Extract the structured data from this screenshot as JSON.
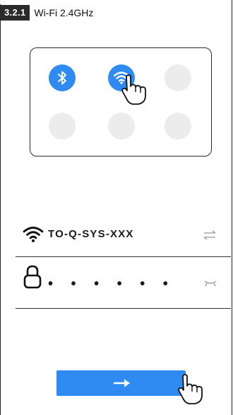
{
  "header": {
    "section_number": "3.2.1",
    "title": "Wi-Fi 2.4GHz"
  },
  "control_center": {
    "toggles": [
      {
        "name": "bluetooth",
        "icon": "bluetooth-icon",
        "state": "on"
      },
      {
        "name": "wifi",
        "icon": "wifi-icon",
        "state": "on"
      },
      {
        "name": "blank-3",
        "state": "off"
      },
      {
        "name": "blank-4",
        "state": "off"
      },
      {
        "name": "blank-5",
        "state": "off"
      },
      {
        "name": "blank-6",
        "state": "off"
      }
    ]
  },
  "network": {
    "ssid": "TO-Q-SYS-XXX",
    "password_mask": "• • • • • •"
  },
  "colors": {
    "accent": "#2f8af2",
    "inactive_toggle": "#ececec",
    "badge_bg": "#2b2b2b"
  }
}
